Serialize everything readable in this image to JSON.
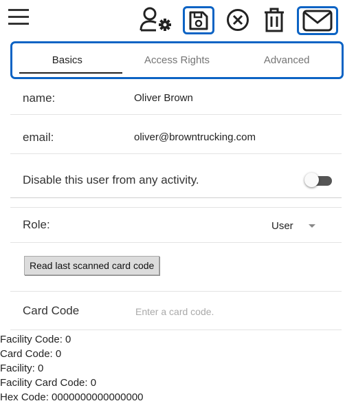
{
  "toolbar": {
    "icons": [
      "menu-icon",
      "user-settings-icon",
      "save-icon",
      "cancel-icon",
      "trash-icon",
      "mail-icon"
    ]
  },
  "tabs": [
    {
      "label": "Basics",
      "active": true
    },
    {
      "label": "Access Rights",
      "active": false
    },
    {
      "label": "Advanced",
      "active": false
    }
  ],
  "form": {
    "name_label": "name:",
    "name_value": "Oliver Brown",
    "email_label": "email:",
    "email_value": "oliver@browntrucking.com",
    "disable_label": "Disable this user from any activity.",
    "disable_enabled": false,
    "role_label": "Role:",
    "role_value": "User",
    "read_button": "Read last scanned card code",
    "card_label": "Card Code",
    "card_placeholder": "Enter a card code."
  },
  "codes": {
    "facility_code": "Facility Code: 0",
    "card_code": "Card Code: 0",
    "facility": "Facility: 0",
    "facility_card_code": "Facility Card Code: 0",
    "hex_code": "Hex Code: 0000000000000000"
  },
  "colors": {
    "highlight": "#0b63c4",
    "toggle_track": "#555555"
  }
}
